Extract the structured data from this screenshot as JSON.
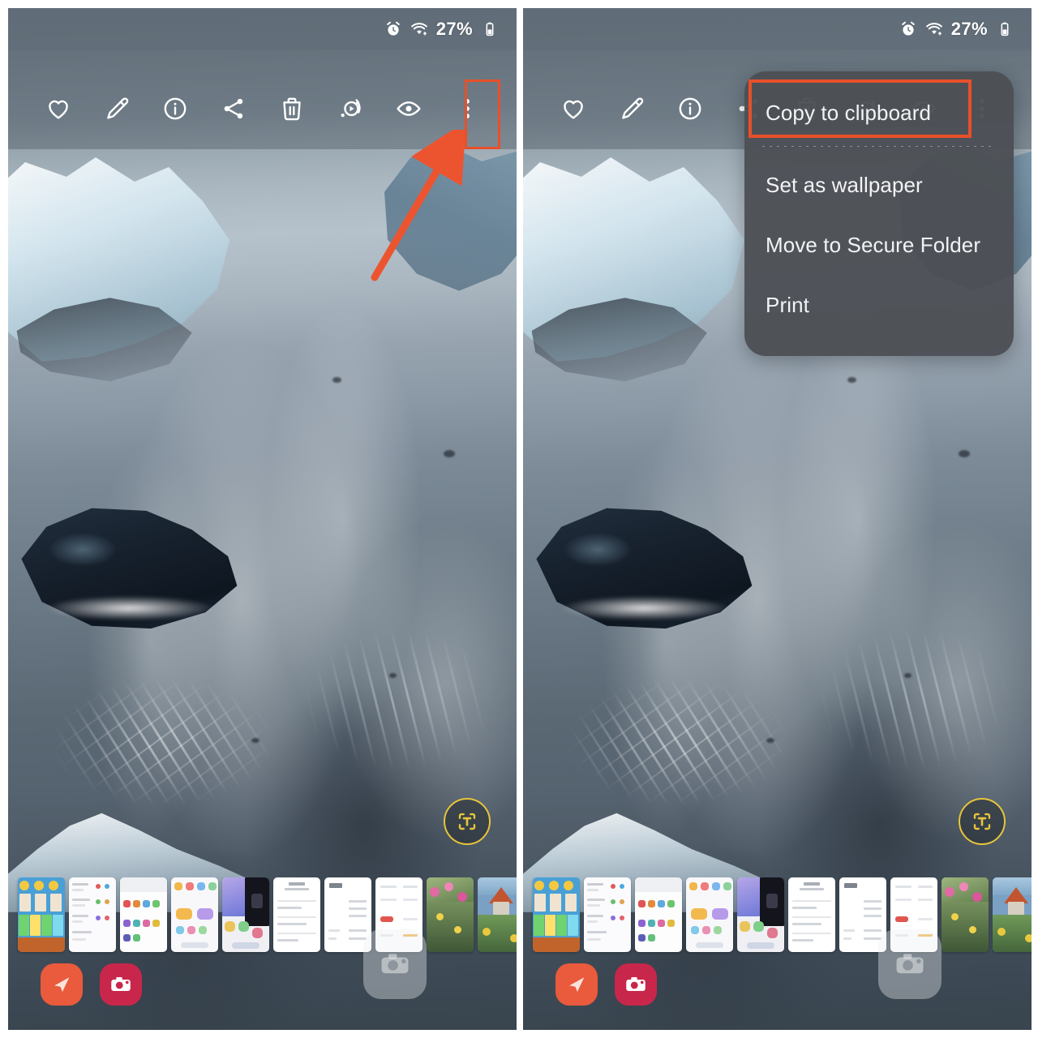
{
  "status_bar": {
    "icons": [
      "alarm-icon",
      "wifi-icon"
    ],
    "battery_percent": "27%",
    "battery_icon": "battery-icon"
  },
  "photo_toolbar": {
    "buttons": [
      {
        "name": "favorite-button",
        "icon": "heart-icon",
        "label": "Favorite"
      },
      {
        "name": "edit-button",
        "icon": "pencil-icon",
        "label": "Edit"
      },
      {
        "name": "info-button",
        "icon": "info-circle-icon",
        "label": "Details"
      },
      {
        "name": "share-button",
        "icon": "share-icon",
        "label": "Share"
      },
      {
        "name": "delete-button",
        "icon": "trash-icon",
        "label": "Delete"
      },
      {
        "name": "motion-photo-button",
        "icon": "play-circle-icon",
        "label": "Motion photo"
      },
      {
        "name": "view-button",
        "icon": "eye-icon",
        "label": "View"
      },
      {
        "name": "more-options-button",
        "icon": "kebab-menu-icon",
        "label": "More options"
      }
    ]
  },
  "overflow_menu": {
    "items": [
      {
        "label": "Copy to clipboard",
        "highlighted": true
      },
      {
        "label": "Set as wallpaper",
        "highlighted": false
      },
      {
        "label": "Move to Secure Folder",
        "highlighted": false
      },
      {
        "label": "Print",
        "highlighted": false
      }
    ]
  },
  "ocr_button": {
    "name": "text-extract-button",
    "glyph": "T"
  },
  "dock": {
    "apps": [
      {
        "name": "send-app-icon",
        "icon": "paper-plane-icon"
      },
      {
        "name": "camera-app-icon",
        "icon": "camera-icon"
      },
      {
        "name": "camera-shortcut-icon",
        "icon": "camera-icon"
      }
    ]
  },
  "annotations": {
    "highlight_color": "#e8502a",
    "arrow": {
      "name": "pointer-arrow",
      "points_to": "more-options-button"
    },
    "boxes": [
      {
        "name": "kebab-highlight-box",
        "target": "more-options-button"
      },
      {
        "name": "copy-to-clipboard-highlight-box",
        "target": "menu-item-copy-to-clipboard"
      }
    ]
  },
  "panels": [
    {
      "name": "panel-before-menu",
      "caption": ""
    },
    {
      "name": "panel-menu-open",
      "caption": ""
    }
  ],
  "filmstrip": {
    "name": "photo-filmstrip",
    "thumbnails": [
      {
        "name": "thumb-game",
        "tone": "#7cc67c"
      },
      {
        "name": "thumb-chat-1",
        "tone": "#f4f4f6"
      },
      {
        "name": "thumb-apps-1",
        "tone": "#fbfbfd"
      },
      {
        "name": "thumb-apps-2",
        "tone": "#f7f7fa"
      },
      {
        "name": "thumb-dark-ui",
        "tone": "#2a2a30"
      },
      {
        "name": "thumb-doc-1",
        "tone": "#ffffff"
      },
      {
        "name": "thumb-doc-2",
        "tone": "#ffffff"
      },
      {
        "name": "thumb-doc-3",
        "tone": "#ffffff"
      },
      {
        "name": "thumb-flowers",
        "tone": "#d4679a"
      },
      {
        "name": "thumb-garden",
        "tone": "#e2b83c"
      },
      {
        "name": "thumb-notes-1",
        "tone": "#f2ece2"
      },
      {
        "name": "thumb-notes-2",
        "tone": "#efe7da"
      },
      {
        "name": "thumb-dark-2",
        "tone": "#1e1e26"
      }
    ]
  }
}
